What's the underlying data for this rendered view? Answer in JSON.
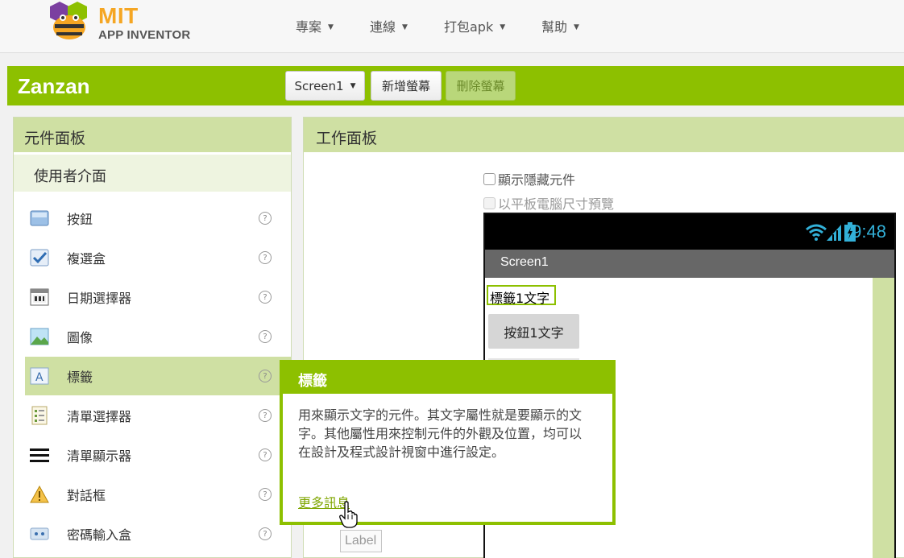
{
  "header": {
    "logo_title": "MIT",
    "logo_subtitle": "APP INVENTOR",
    "menu": [
      {
        "label": "專案"
      },
      {
        "label": "連線"
      },
      {
        "label": "打包apk"
      },
      {
        "label": "幫助"
      }
    ]
  },
  "project": {
    "name": "Zanzan",
    "screen_select": "Screen1",
    "add_screen": "新增螢幕",
    "remove_screen": "刪除螢幕"
  },
  "palette": {
    "title": "元件面板",
    "category": "使用者介面",
    "help_glyph": "?",
    "items": [
      {
        "label": "按鈕",
        "icon": "button-icon"
      },
      {
        "label": "複選盒",
        "icon": "checkbox-icon"
      },
      {
        "label": "日期選擇器",
        "icon": "datepicker-icon"
      },
      {
        "label": "圖像",
        "icon": "image-icon"
      },
      {
        "label": "標籤",
        "icon": "label-icon",
        "selected": true
      },
      {
        "label": "清單選擇器",
        "icon": "listpicker-icon"
      },
      {
        "label": "清單顯示器",
        "icon": "listview-icon"
      },
      {
        "label": "對話框",
        "icon": "notifier-icon"
      },
      {
        "label": "密碼輸入盒",
        "icon": "passwordtextbox-icon"
      }
    ]
  },
  "viewer": {
    "title": "工作面板",
    "show_hidden": "顯示隱藏元件",
    "tablet_preview": "以平板電腦尺寸預覽",
    "phone": {
      "time": "9:48",
      "screen_title": "Screen1",
      "label_text": "標籤1文字",
      "button_text": "按鈕1文字"
    }
  },
  "tooltip": {
    "title": "標籤",
    "body": "用來顯示文字的元件。其文字屬性就是要顯示的文字。其他屬性用來控制元件的外觀及位置，均可以在設計及程式設計視窗中進行設定。",
    "link": "更多訊息",
    "hover_label": "Label"
  },
  "colors": {
    "brand_green": "#8dc000",
    "panel_green": "#cfe0a3",
    "logo_orange": "#f5a623",
    "clock_blue": "#32b0d8"
  }
}
